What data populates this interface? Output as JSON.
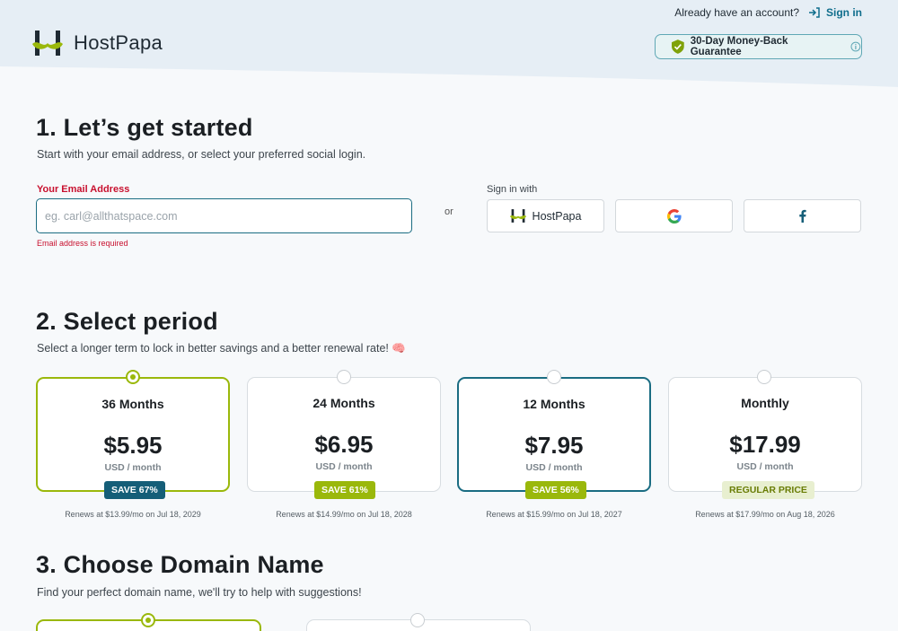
{
  "header": {
    "logo_text": "HostPapa",
    "account_prompt": "Already have an account?",
    "signin_label": "Sign in",
    "guarantee_label": "30-Day Money-Back Guarantee"
  },
  "step1": {
    "title": "1. Let’s get started",
    "subtitle": "Start with your email address, or select your preferred social login.",
    "email_label": "Your Email Address",
    "email_placeholder": "eg. carl@allthatspace.com",
    "email_value": "",
    "email_error": "Email address is required",
    "or_text": "or",
    "signin_with": "Sign in with",
    "social": {
      "hostpapa_label": "HostPapa",
      "google_icon": "google-icon",
      "facebook_icon": "facebook-icon"
    }
  },
  "step2": {
    "title": "2. Select period",
    "subtitle": "Select a longer term to lock in better savings and a better renewal rate! 🧠",
    "plans": [
      {
        "term": "36 Months",
        "price": "$5.95",
        "unit": "USD / month",
        "badge": "SAVE 67%",
        "renews": "Renews at $13.99/mo on Jul 18, 2029",
        "selected": true
      },
      {
        "term": "24 Months",
        "price": "$6.95",
        "unit": "USD / month",
        "badge": "SAVE 61%",
        "renews": "Renews at $14.99/mo on Jul 18, 2028",
        "selected": false
      },
      {
        "term": "12 Months",
        "price": "$7.95",
        "unit": "USD / month",
        "badge": "SAVE 56%",
        "renews": "Renews at $15.99/mo on Jul 18, 2027",
        "selected": false
      },
      {
        "term": "Monthly",
        "price": "$17.99",
        "unit": "USD / month",
        "badge": "REGULAR PRICE",
        "renews": "Renews at $17.99/mo on Aug 18, 2026",
        "selected": false
      }
    ]
  },
  "step3": {
    "title": "3. Choose Domain Name",
    "subtitle": "Find your perfect domain name, we'll try to help with suggestions!"
  },
  "colors": {
    "accent_green": "#9ab80b",
    "accent_teal": "#1a6c82",
    "error_red": "#c8102e"
  }
}
